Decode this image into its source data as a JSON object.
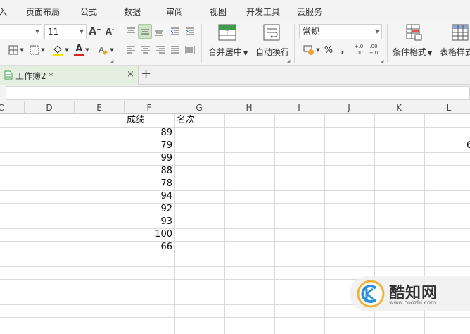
{
  "menu": {
    "items": [
      "入",
      "页面布局",
      "公式",
      "数据",
      "审阅",
      "视图",
      "开发工具",
      "云服务"
    ]
  },
  "ribbon": {
    "font_size": "11",
    "grow_font_label": "A",
    "shrink_font_label": "A",
    "font_color_label": "A",
    "number_format": "常规",
    "merge_center_label": "合并居中",
    "wrap_text_label": "自动换行",
    "percent_label": "%",
    "comma_label": ",",
    "inc_decimal_label": "+.0\n.00",
    "dec_decimal_label": ".00\n+.0",
    "conditional_format_label": "条件格式",
    "table_style_label": "表格样式",
    "merge_icon_glyph": "T"
  },
  "tabs": {
    "document_title": "工作簿2 *",
    "close_glyph": "×",
    "new_tab_glyph": "+"
  },
  "sheet": {
    "columns": [
      "C",
      "D",
      "E",
      "F",
      "G",
      "H",
      "I",
      "J",
      "K",
      "L"
    ],
    "header_score": "成绩",
    "header_rank": "名次",
    "scores": [
      "89",
      "79",
      "99",
      "88",
      "78",
      "94",
      "92",
      "93",
      "100",
      "66"
    ],
    "partial_cell_L3": "6"
  },
  "watermark": {
    "name": "酷知网",
    "url": "www.coozhi.com"
  },
  "colors": {
    "selected_button": "#cfe3c8",
    "tab_active": "#e4efe0",
    "font_color_bar": "#d9251d",
    "highlight_bar": "#f5e400"
  }
}
